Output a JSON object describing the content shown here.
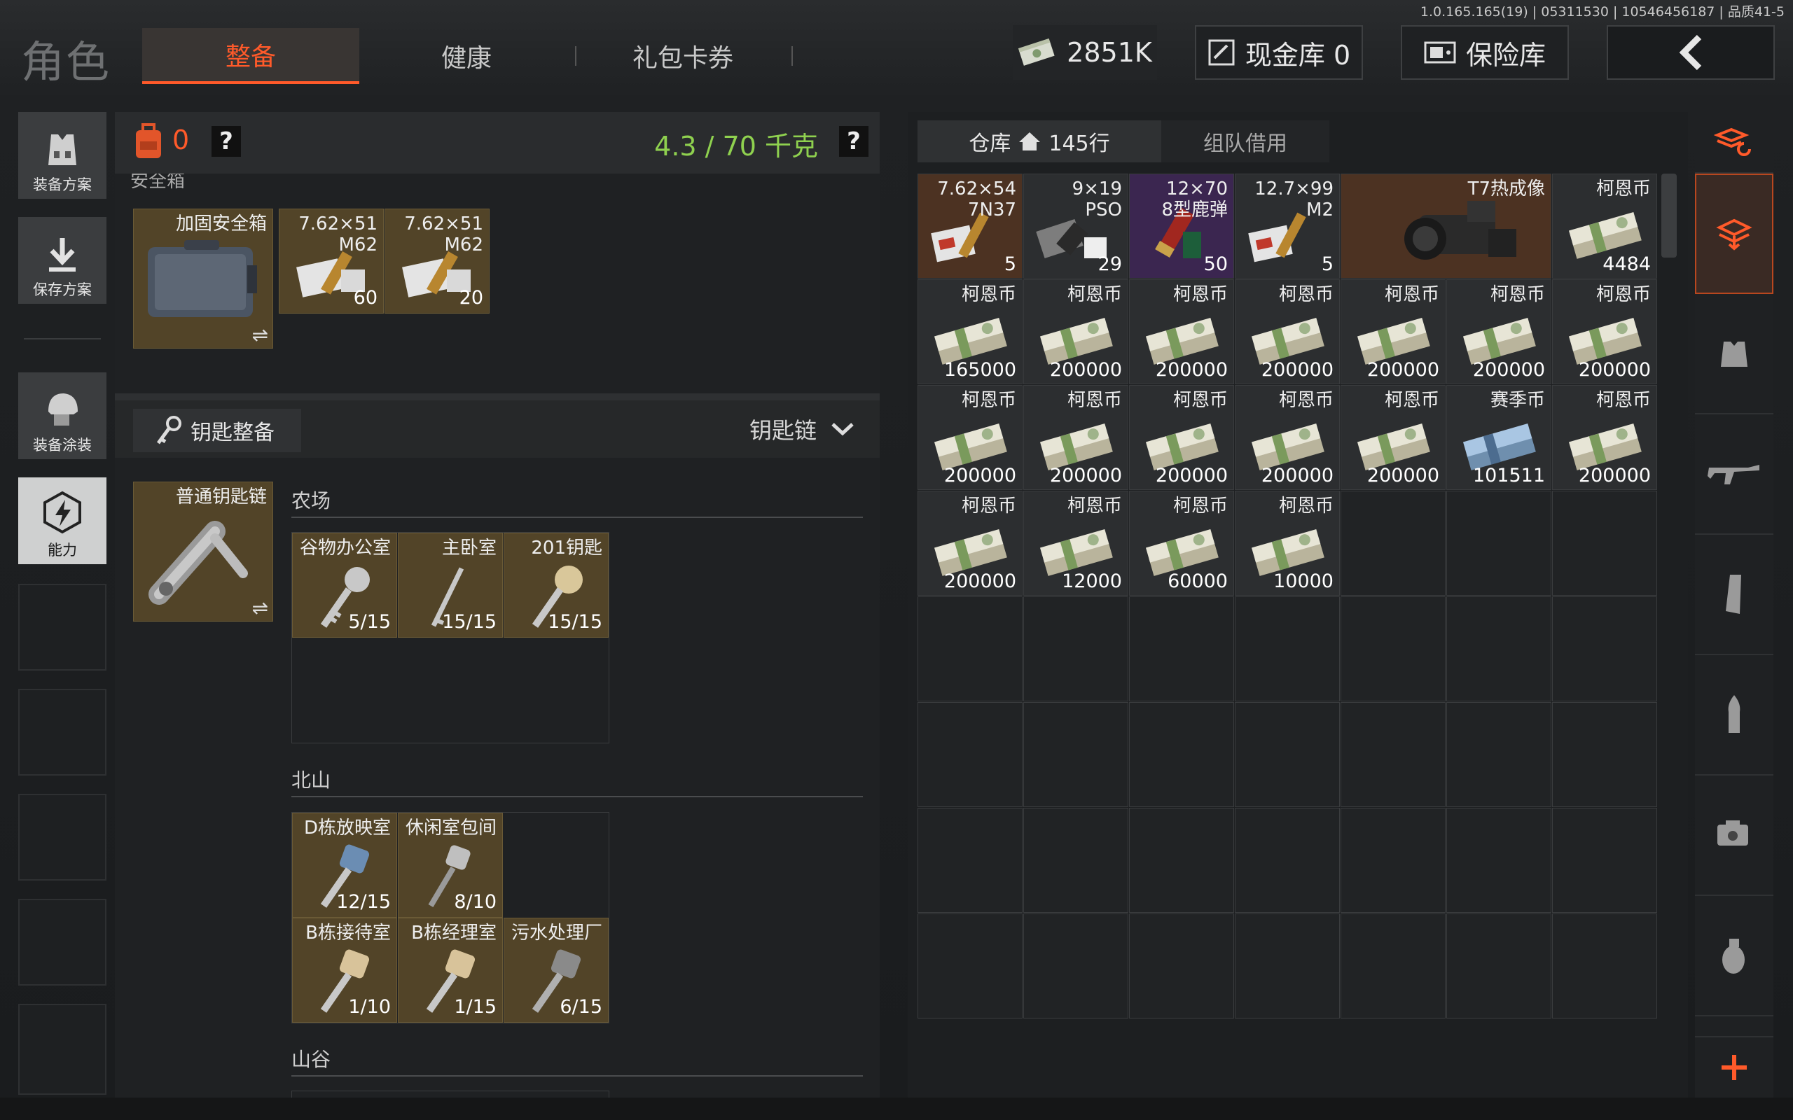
{
  "version": "1.0.165.165(19) | 05311530 | 10546456187 | 品质41-5",
  "header": {
    "title": "角色",
    "tabs": [
      "整备",
      "健康",
      "礼包卡券"
    ],
    "currency": "2851K",
    "cash_vault": "现金库 0",
    "safe_vault": "保险库"
  },
  "sidebar": {
    "items": [
      {
        "label": "装备方案",
        "icon": "vest-icon"
      },
      {
        "label": "保存方案",
        "icon": "download-icon"
      },
      {
        "label": "装备涂装",
        "icon": "helmet-icon"
      },
      {
        "label": "能力",
        "icon": "bolt-icon"
      }
    ]
  },
  "loadout": {
    "count": "0",
    "help": "?",
    "weight": "4.3 / 70 千克",
    "safebox_label": "安全箱",
    "safebox": {
      "name": "加固安全箱"
    },
    "safebox_items": [
      {
        "name": "7.62×51\nM62",
        "count": "60"
      },
      {
        "name": "7.62×51\nM62",
        "count": "20"
      }
    ]
  },
  "keys": {
    "title": "钥匙整备",
    "dropdown": "钥匙链",
    "keychain": "普通钥匙链",
    "sections": [
      {
        "name": "农场",
        "items": [
          {
            "name": "谷物办公室",
            "count": "5/15"
          },
          {
            "name": "主卧室",
            "count": "15/15"
          },
          {
            "name": "201钥匙",
            "count": "15/15"
          }
        ]
      },
      {
        "name": "北山",
        "items": [
          {
            "name": "D栋放映室",
            "count": "12/15"
          },
          {
            "name": "休闲室包间",
            "count": "8/10"
          },
          {
            "name": "B栋接待室",
            "count": "1/10"
          },
          {
            "name": "B栋经理室",
            "count": "1/15"
          },
          {
            "name": "污水处理厂",
            "count": "6/15"
          }
        ]
      },
      {
        "name": "山谷",
        "items": []
      }
    ]
  },
  "warehouse": {
    "tab_storage": "仓库",
    "rows": "145行",
    "tab_team": "组队借用",
    "items": [
      {
        "name": "7.62×54\n7N37",
        "count": "5",
        "type": "ammo",
        "bg": "#4c3222"
      },
      {
        "name": "9×19\nPSO",
        "count": "29",
        "type": "ammo-dark",
        "bg": "#2c2e30"
      },
      {
        "name": "12×70\n8型鹿弹",
        "count": "50",
        "type": "shell",
        "bg": "#3b2650"
      },
      {
        "name": "12.7×99\nM2",
        "count": "5",
        "type": "ammo",
        "bg": "#2c2e30"
      },
      {
        "name": "T7热成像",
        "count": "",
        "type": "scope",
        "bg": "#4c3222",
        "wide": true
      },
      {
        "name": "柯恩币",
        "count": "4484",
        "type": "cash",
        "bg": "#2c2e30"
      },
      {
        "name": "柯恩币",
        "count": "165000",
        "type": "cash",
        "bg": "#2c2e30"
      },
      {
        "name": "柯恩币",
        "count": "200000",
        "type": "cash",
        "bg": "#2c2e30"
      },
      {
        "name": "柯恩币",
        "count": "200000",
        "type": "cash",
        "bg": "#2c2e30"
      },
      {
        "name": "柯恩币",
        "count": "200000",
        "type": "cash",
        "bg": "#2c2e30"
      },
      {
        "name": "柯恩币",
        "count": "200000",
        "type": "cash",
        "bg": "#2c2e30"
      },
      {
        "name": "柯恩币",
        "count": "200000",
        "type": "cash",
        "bg": "#2c2e30"
      },
      {
        "name": "柯恩币",
        "count": "200000",
        "type": "cash",
        "bg": "#2c2e30"
      },
      {
        "name": "柯恩币",
        "count": "200000",
        "type": "cash",
        "bg": "#2c2e30"
      },
      {
        "name": "柯恩币",
        "count": "200000",
        "type": "cash",
        "bg": "#2c2e30"
      },
      {
        "name": "柯恩币",
        "count": "200000",
        "type": "cash",
        "bg": "#2c2e30"
      },
      {
        "name": "柯恩币",
        "count": "200000",
        "type": "cash",
        "bg": "#2c2e30"
      },
      {
        "name": "柯恩币",
        "count": "200000",
        "type": "cash",
        "bg": "#2c2e30"
      },
      {
        "name": "赛季币",
        "count": "101511",
        "type": "season",
        "bg": "#2c2e30"
      },
      {
        "name": "柯恩币",
        "count": "200000",
        "type": "cash",
        "bg": "#2c2e30"
      },
      {
        "name": "柯恩币",
        "count": "200000",
        "type": "cash",
        "bg": "#2c2e30"
      },
      {
        "name": "柯恩币",
        "count": "12000",
        "type": "cash",
        "bg": "#2c2e30"
      },
      {
        "name": "柯恩币",
        "count": "60000",
        "type": "cash",
        "bg": "#2c2e30"
      },
      {
        "name": "柯恩币",
        "count": "10000",
        "type": "cash",
        "bg": "#2c2e30"
      }
    ]
  },
  "right_toolbar": [
    "sort-icon",
    "storage-icon",
    "armor-icon",
    "rifle-icon",
    "magazine-icon",
    "bullet-icon",
    "gear-icon",
    "grenade-icon",
    "add-icon"
  ],
  "colors": {
    "accent": "#ff5a2a",
    "weight": "#8fd14f",
    "gold_slot": "#524428"
  }
}
